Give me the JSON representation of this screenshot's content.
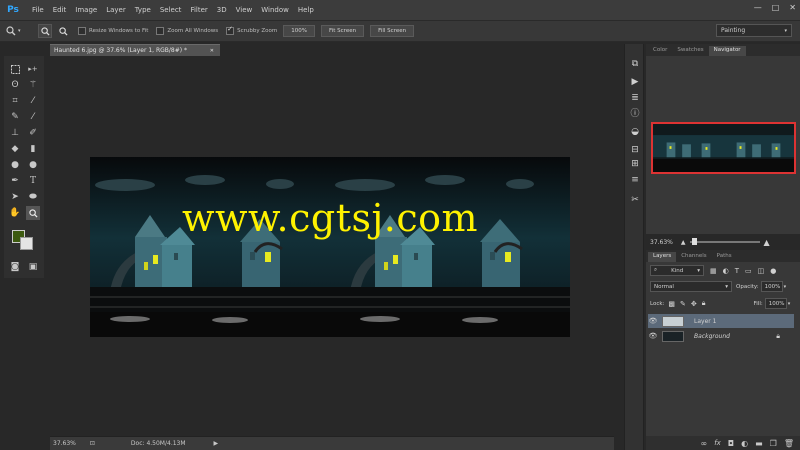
{
  "app": {
    "logo": "Ps"
  },
  "menu": [
    "File",
    "Edit",
    "Image",
    "Layer",
    "Type",
    "Select",
    "Filter",
    "3D",
    "View",
    "Window",
    "Help"
  ],
  "window_controls": {
    "minimize": "—",
    "maximize": "□",
    "close": "✕"
  },
  "options_bar": {
    "tool_icon": "zoom-icon",
    "checkboxes": [
      {
        "label": "Resize Windows to Fit",
        "checked": false
      },
      {
        "label": "Zoom All Windows",
        "checked": false
      },
      {
        "label": "Scrubby Zoom",
        "checked": true
      }
    ],
    "buttons": [
      "100%",
      "Fit Screen",
      "Fill Screen"
    ],
    "workspace": "Painting"
  },
  "document": {
    "tab_title": "Haunted 6.jpg @ 37.6% (Layer 1, RGB/8#) *",
    "watermark": "www.cgtsj.com",
    "colors": {
      "foreground": "#3d5a10",
      "background": "#e4e4e4"
    }
  },
  "status_bar": {
    "zoom": "37.63%",
    "doc_info": "Doc: 4.50M/4.13M"
  },
  "navigator": {
    "tabs": [
      "Color",
      "Swatches",
      "Navigator"
    ],
    "active_tab": "Navigator",
    "zoom": "37.63%"
  },
  "layers_panel": {
    "tabs": [
      "Layers",
      "Channels",
      "Paths"
    ],
    "active_tab": "Layers",
    "filter": "Kind",
    "blend_mode": "Normal",
    "opacity_label": "Opacity:",
    "opacity": "100%",
    "lock_label": "Lock:",
    "fill_label": "Fill:",
    "fill": "100%",
    "layers": [
      {
        "name": "Layer 1",
        "visible": true,
        "selected": true
      },
      {
        "name": "Background",
        "visible": true,
        "selected": false,
        "locked": true
      }
    ]
  }
}
